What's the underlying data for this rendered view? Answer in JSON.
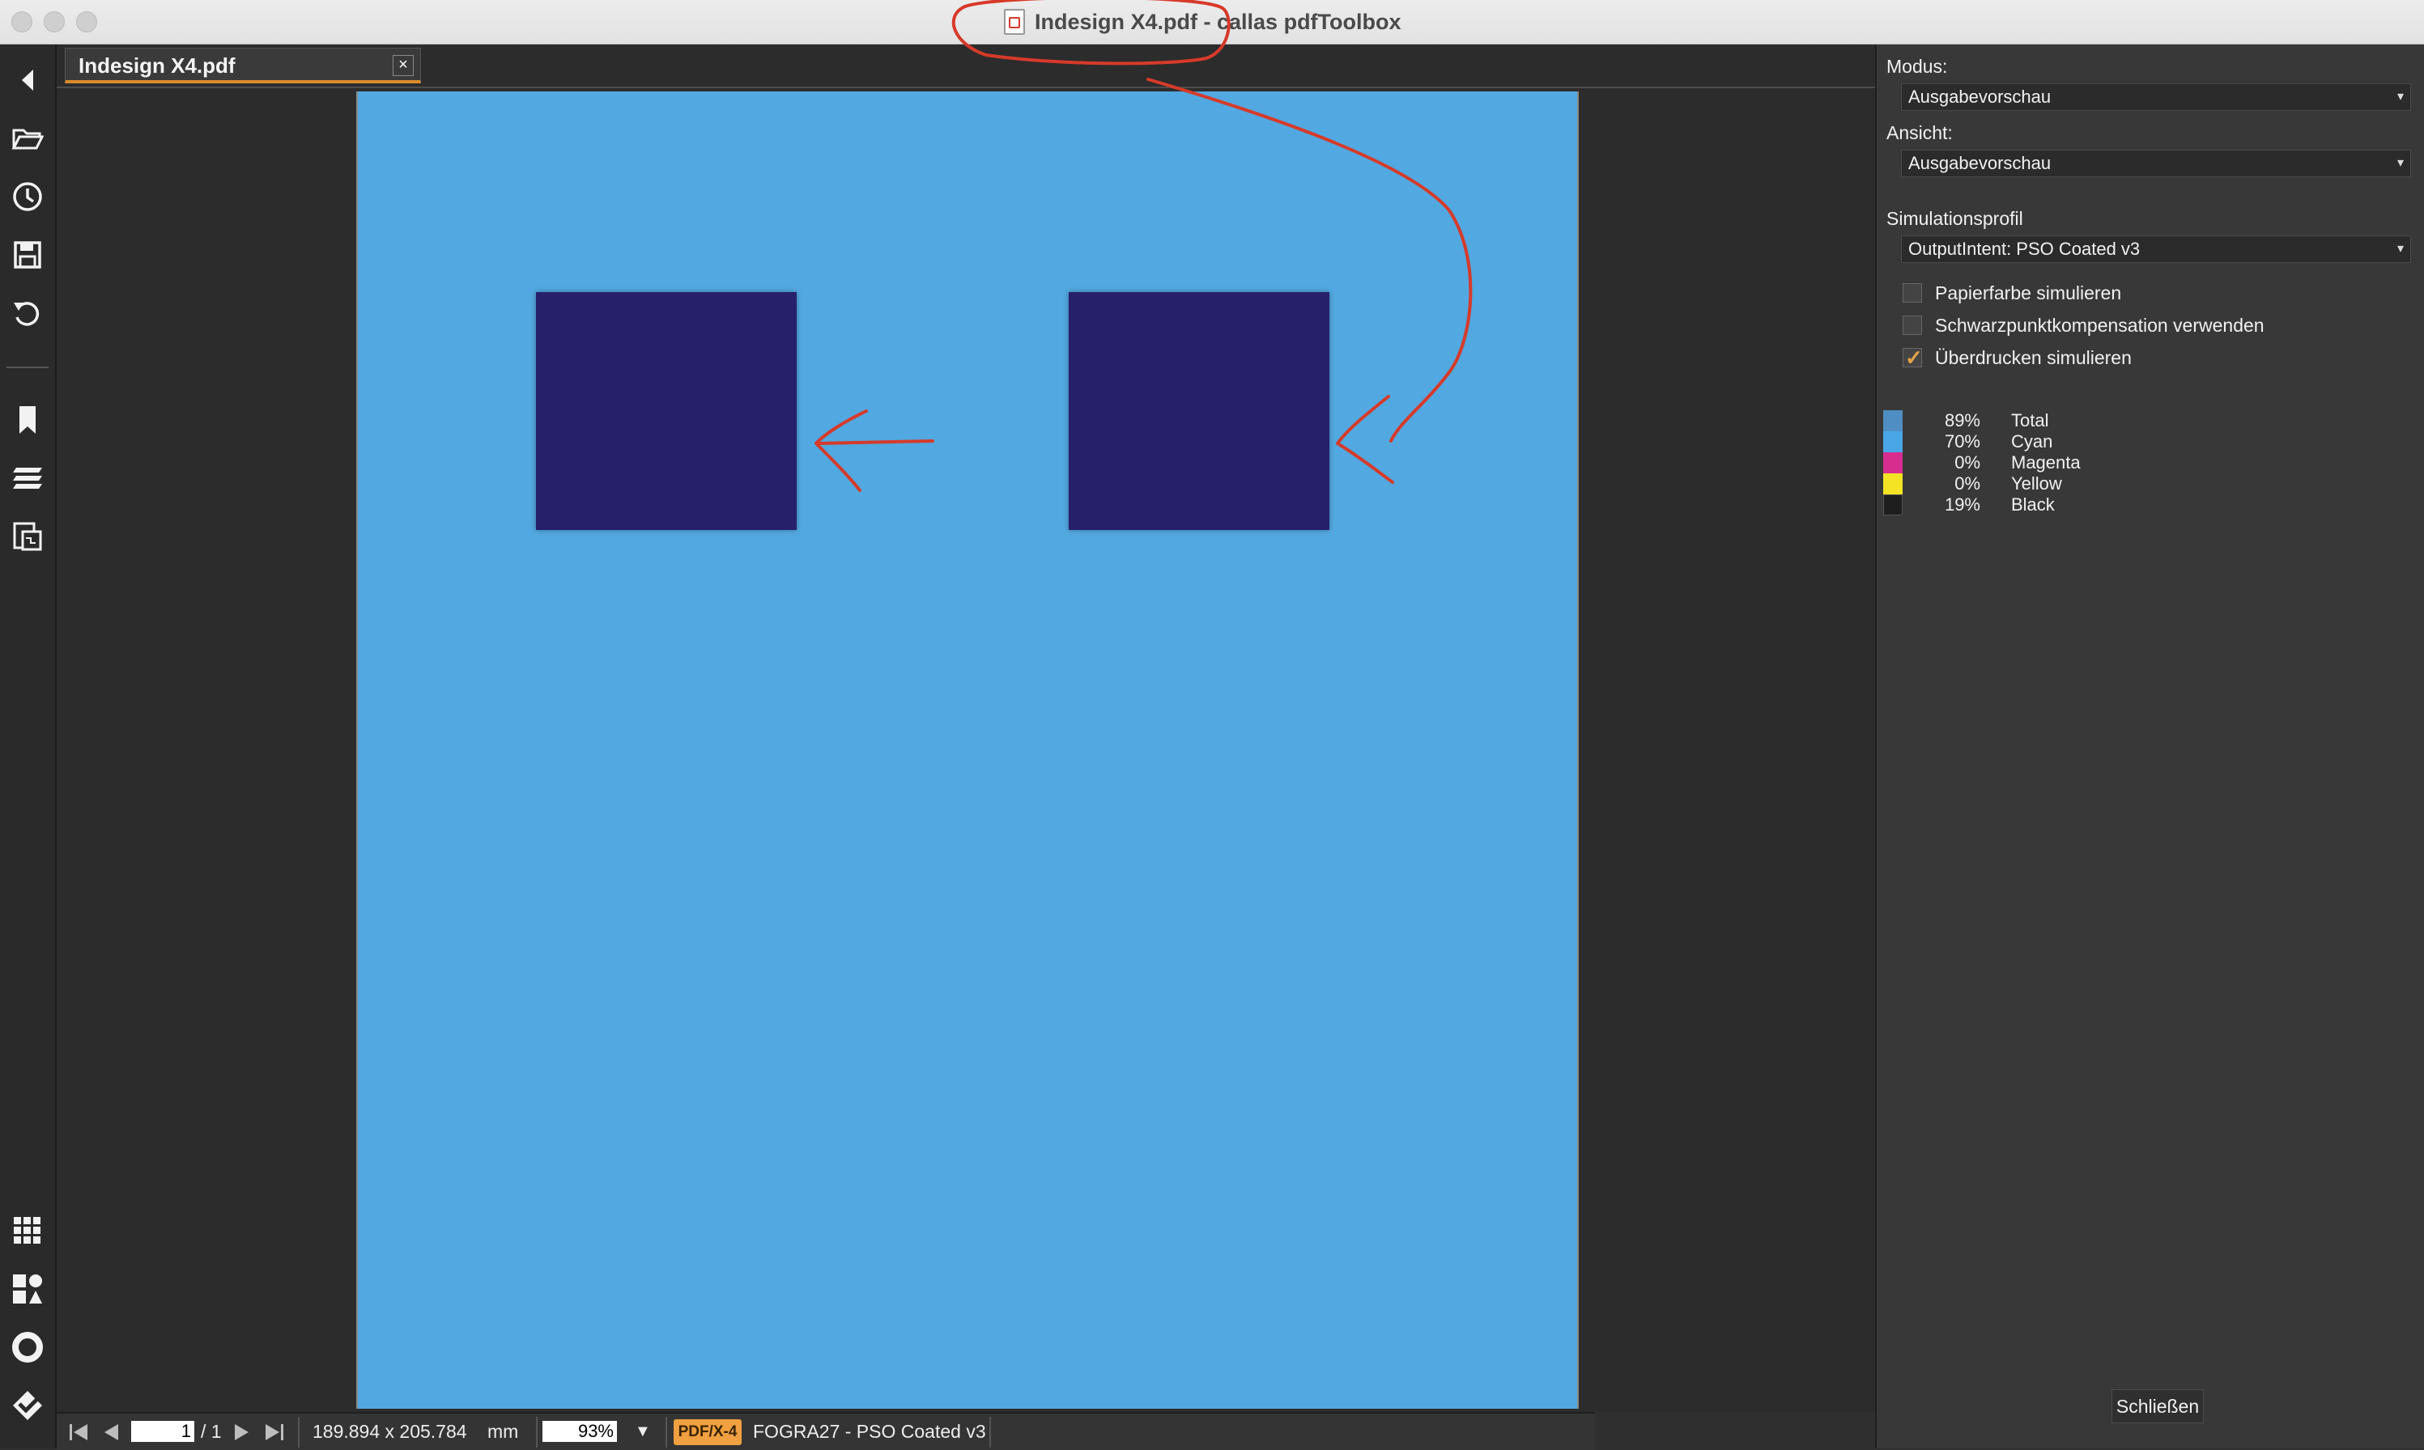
{
  "window": {
    "title": "Indesign X4.pdf - callas pdfToolbox"
  },
  "document": {
    "tab_label": "Indesign X4.pdf",
    "tab_close_glyph": "×"
  },
  "statusbar": {
    "page_current": "1",
    "page_total": "/ 1",
    "dimensions": "189.894 x 205.784",
    "unit": "mm",
    "zoom": "93%",
    "zoom_arrow": "▼",
    "pdfx_badge": "PDF/X-4",
    "output_intent": "FOGRA27 - PSO Coated v3"
  },
  "panel": {
    "modus_label": "Modus:",
    "modus_value": "Ausgabevorschau",
    "ansicht_label": "Ansicht:",
    "ansicht_value": "Ausgabevorschau",
    "simulation_label": "Simulationsprofil",
    "simulation_value": "OutputIntent: PSO Coated v3",
    "checkboxes": [
      {
        "label": "Papierfarbe simulieren",
        "checked": false
      },
      {
        "label": "Schwarzpunktkompensation verwenden",
        "checked": false
      },
      {
        "label": "Überdrucken simulieren",
        "checked": true
      }
    ],
    "inks": [
      {
        "percent": "89%",
        "name": "Total",
        "color": "#4f8ec2"
      },
      {
        "percent": "70%",
        "name": "Cyan",
        "color": "#4aa6e6"
      },
      {
        "percent": "0%",
        "name": "Magenta",
        "color": "#d62d8f"
      },
      {
        "percent": "0%",
        "name": "Yellow",
        "color": "#f3e324"
      },
      {
        "percent": "19%",
        "name": "Black",
        "color": "#1e1e1e"
      }
    ],
    "close_label": "Schließen"
  },
  "colors": {
    "page_background": "#52a8e0",
    "square_fill": "#26206b",
    "annotation_red": "#d63a2a",
    "tab_accent": "#d98b2b",
    "pdfx_badge": "#f0a040"
  },
  "icons": {
    "left_toolbar": [
      "collapse-arrow-icon",
      "folder-open-icon",
      "clock-icon",
      "save-icon",
      "undo-icon",
      "bookmark-icon",
      "layers-icon",
      "pages-icon",
      "grid-icon",
      "tools-icon",
      "circle-icon",
      "check-diamond-icon"
    ]
  }
}
